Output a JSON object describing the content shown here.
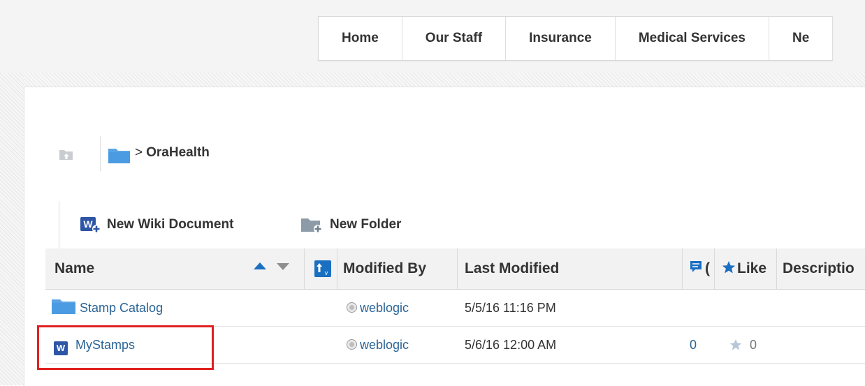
{
  "nav": {
    "items": [
      "Home",
      "Our Staff",
      "Insurance",
      "Medical Services",
      "Ne"
    ]
  },
  "breadcrumb": {
    "separator": ">",
    "current": "OraHealth"
  },
  "toolbar": {
    "new_wiki_label": "New Wiki Document",
    "new_folder_label": "New Folder"
  },
  "table": {
    "columns": {
      "name": "Name",
      "modified_by": "Modified By",
      "last_modified": "Last Modified",
      "comments": "(",
      "like": "Like",
      "description": "Descriptio"
    },
    "rows": [
      {
        "type": "folder",
        "name": "Stamp Catalog",
        "modified_by": "weblogic",
        "last_modified": "5/5/16 11:16 PM",
        "comments": "",
        "likes": ""
      },
      {
        "type": "wiki",
        "icon_letter": "W",
        "name": "MyStamps",
        "modified_by": "weblogic",
        "last_modified": "5/6/16 12:00 AM",
        "comments": "0",
        "likes": "0"
      }
    ]
  },
  "colors": {
    "link": "#2a6496",
    "accent": "#1a6fc1",
    "highlight": "#e02020"
  }
}
